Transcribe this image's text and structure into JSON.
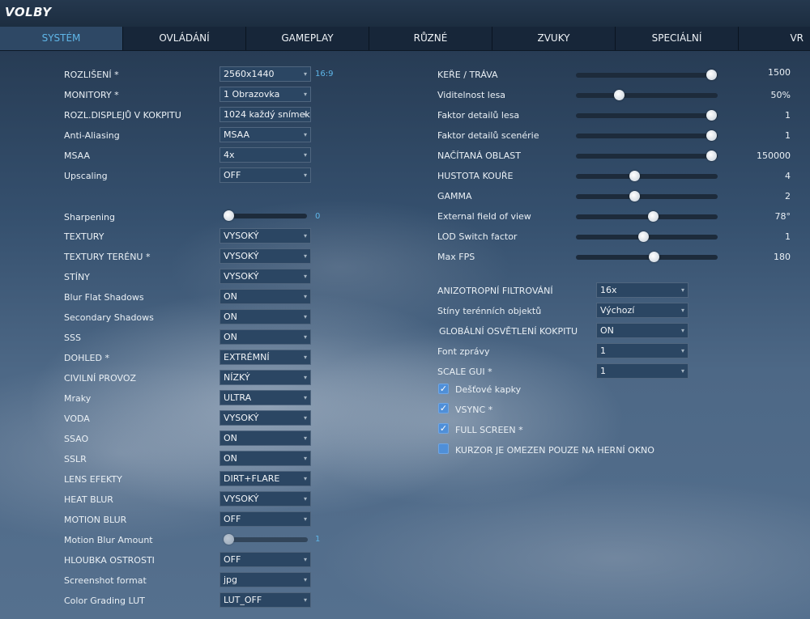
{
  "window": {
    "title": "VOLBY"
  },
  "tabs": [
    {
      "label": "SYSTÉM",
      "active": true
    },
    {
      "label": "OVLÁDÁNÍ",
      "active": false
    },
    {
      "label": "GAMEPLAY",
      "active": false
    },
    {
      "label": "RŮZNÉ",
      "active": false
    },
    {
      "label": "ZVUKY",
      "active": false
    },
    {
      "label": "SPECIÁLNÍ",
      "active": false
    },
    {
      "label": "VR",
      "active": false
    }
  ],
  "left": {
    "resolution": {
      "label": "ROZLIŠENÍ *",
      "value": "2560x1440",
      "aspect": "16:9"
    },
    "monitors": {
      "label": "MONITORY *",
      "value": "1 Obrazovka"
    },
    "cockpit_res": {
      "label": "ROZL.DISPLEJŮ V KOKPITU",
      "value": "1024 každý snímek"
    },
    "anti_aliasing": {
      "label": "Anti-Aliasing",
      "value": "MSAA"
    },
    "msaa": {
      "label": "MSAA",
      "value": "4x"
    },
    "upscaling": {
      "label": "Upscaling",
      "value": "OFF"
    },
    "sharpening": {
      "label": "Sharpening",
      "value": "0",
      "level": 0
    },
    "textures": {
      "label": "TEXTURY",
      "value": "VYSOKÝ"
    },
    "terrain_textures": {
      "label": "TEXTURY TERÉNU *",
      "value": "VYSOKÝ"
    },
    "shadows": {
      "label": "STÍNY",
      "value": "VYSOKÝ"
    },
    "blur_flat_shadows": {
      "label": "Blur Flat Shadows",
      "value": "ON"
    },
    "secondary_shadows": {
      "label": "Secondary Shadows",
      "value": "ON"
    },
    "sss": {
      "label": "SSS",
      "value": "ON"
    },
    "visibility": {
      "label": "DOHLED *",
      "value": "EXTRÉMNÍ"
    },
    "civil_traffic": {
      "label": "CIVILNÍ PROVOZ",
      "value": "NÍZKÝ"
    },
    "clouds": {
      "label": "Mraky",
      "value": "ULTRA"
    },
    "water": {
      "label": "VODA",
      "value": "VYSOKÝ"
    },
    "ssao": {
      "label": "SSAO",
      "value": "ON"
    },
    "sslr": {
      "label": "SSLR",
      "value": "ON"
    },
    "lens_effects": {
      "label": "LENS EFEKTY",
      "value": "DIRT+FLARE"
    },
    "heat_blur": {
      "label": "HEAT BLUR",
      "value": "VYSOKÝ"
    },
    "motion_blur": {
      "label": "MOTION BLUR",
      "value": "OFF"
    },
    "motion_blur_amount": {
      "label": "Motion Blur Amount",
      "value": "1",
      "level": 0
    },
    "depth_of_field": {
      "label": "HLOUBKA OSTROSTI",
      "value": "OFF"
    },
    "screenshot_format": {
      "label": "Screenshot format",
      "value": "jpg"
    },
    "color_grading": {
      "label": "Color Grading LUT",
      "value": "LUT_OFF"
    }
  },
  "right": {
    "sliders": [
      {
        "label": "KEŘE / TRÁVA",
        "value": "1500",
        "level": 1.0
      },
      {
        "label": "Viditelnost lesa",
        "value": "50%",
        "level": 0.29
      },
      {
        "label": "Faktor detailů lesa",
        "value": "1",
        "level": 1.0
      },
      {
        "label": "Faktor detailů scenérie",
        "value": "1",
        "level": 1.0
      },
      {
        "label": "NAČÍTANÁ OBLAST",
        "value": "150000",
        "level": 1.0
      },
      {
        "label": "HUSTOTA KOUŘE",
        "value": "4",
        "level": 0.41
      },
      {
        "label": "GAMMA",
        "value": "2",
        "level": 0.41
      },
      {
        "label": "External field of view",
        "value": "78°",
        "level": 0.55
      },
      {
        "label": "LOD Switch factor",
        "value": "1",
        "level": 0.48
      },
      {
        "label": "Max FPS",
        "value": "180",
        "level": 0.56
      }
    ],
    "anisotropic": {
      "label": "ANIZOTROPNÍ FILTROVÁNÍ",
      "value": "16x"
    },
    "terrain_object_shadows": {
      "label": "Stíny terénních objektů",
      "value": "Výchozí"
    },
    "cockpit_gi": {
      "label": "GLOBÁLNÍ OSVĚTLENÍ KOKPITU",
      "value": "ON"
    },
    "message_font": {
      "label": "Font zprávy",
      "value": "1"
    },
    "scale_gui": {
      "label": "SCALE GUI *",
      "value": "1"
    },
    "checkboxes": [
      {
        "label": "Dešťové kapky",
        "checked": true
      },
      {
        "label": "VSYNC *",
        "checked": true
      },
      {
        "label": "FULL SCREEN *",
        "checked": true
      },
      {
        "label": "KURZOR JE OMEZEN POUZE NA HERNÍ OKNO",
        "checked": false
      }
    ]
  },
  "icons": {
    "dropdown_arrow": "▾",
    "check": "✓"
  }
}
